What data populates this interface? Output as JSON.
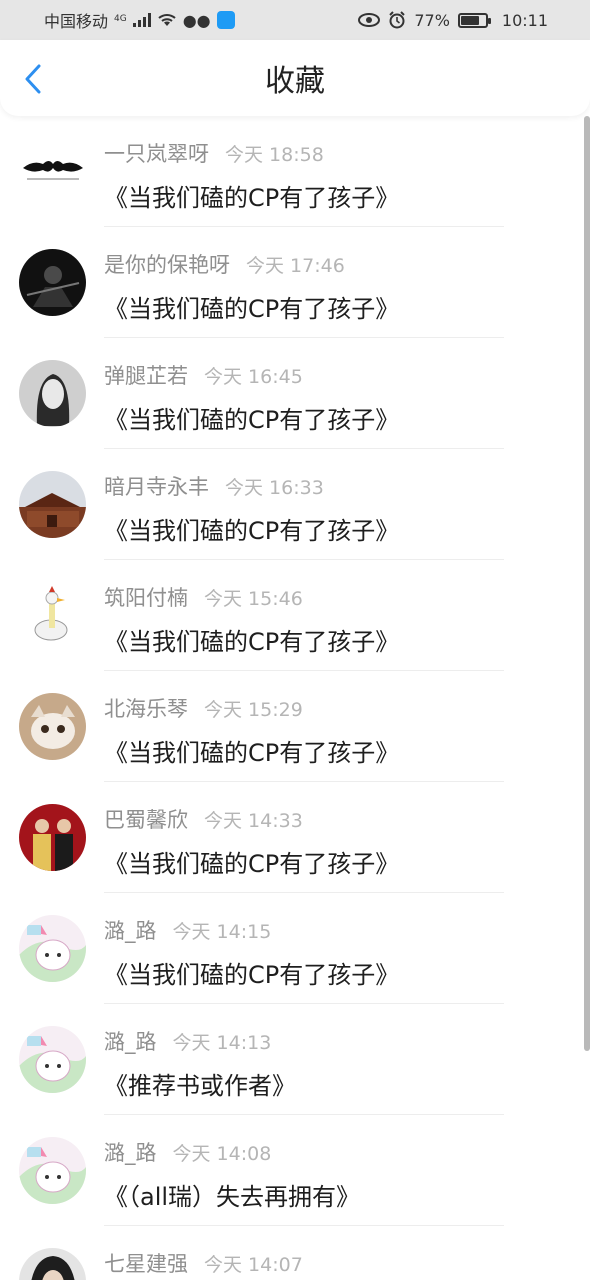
{
  "status": {
    "carrier": "中国移动",
    "network": "4G",
    "battery": "77%",
    "battery_level": 0.77,
    "time": "10:11"
  },
  "header": {
    "title": "收藏"
  },
  "items": [
    {
      "user": "一只岚翠呀",
      "time": "今天 18:58",
      "book": "《当我们磕的CP有了孩子》",
      "avatar": "mustache"
    },
    {
      "user": "是你的保艳呀",
      "time": "今天 17:46",
      "book": "《当我们磕的CP有了孩子》",
      "avatar": "dark"
    },
    {
      "user": "弹腿芷若",
      "time": "今天 16:45",
      "book": "《当我们磕的CP有了孩子》",
      "avatar": "portrait-gray"
    },
    {
      "user": "暗月寺永丰",
      "time": "今天 16:33",
      "book": "《当我们磕的CP有了孩子》",
      "avatar": "temple"
    },
    {
      "user": "筑阳付楠",
      "time": "今天 15:46",
      "book": "《当我们磕的CP有了孩子》",
      "avatar": "goose"
    },
    {
      "user": "北海乐琴",
      "time": "今天 15:29",
      "book": "《当我们磕的CP有了孩子》",
      "avatar": "cat"
    },
    {
      "user": "巴蜀馨欣",
      "time": "今天 14:33",
      "book": "《当我们磕的CP有了孩子》",
      "avatar": "couple"
    },
    {
      "user": "潞_路",
      "time": "今天 14:15",
      "book": "《当我们磕的CP有了孩子》",
      "avatar": "kitty"
    },
    {
      "user": "潞_路",
      "time": "今天 14:13",
      "book": "《推荐书或作者》",
      "avatar": "kitty"
    },
    {
      "user": "潞_路",
      "time": "今天 14:08",
      "book": "《（all瑞）失去再拥有》",
      "avatar": "kitty"
    },
    {
      "user": "七星建强",
      "time": "今天 14:07",
      "book": "",
      "avatar": "dark-hair"
    }
  ]
}
